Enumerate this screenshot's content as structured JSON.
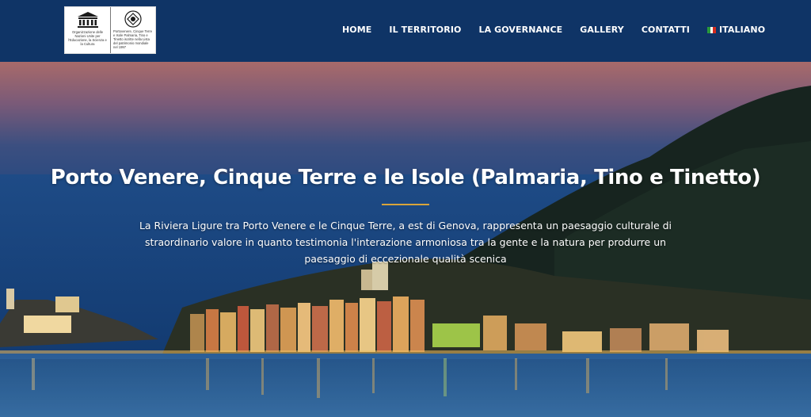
{
  "header": {
    "logo": {
      "unesco_text": "Organizzazione delle Nazioni Unite per l'Educazione, la Scienza e la Cultura",
      "site_text": "Portovenere, Cinque Terre e Isole Palmaria, Tino e Tinetto iscritte nella Lista del patrimonio mondiale nel 1997"
    },
    "nav": [
      {
        "label": "HOME"
      },
      {
        "label": "IL TERRITORIO"
      },
      {
        "label": "LA GOVERNANCE"
      },
      {
        "label": "GALLERY"
      },
      {
        "label": "CONTATTI"
      },
      {
        "label": "ITALIANO"
      }
    ]
  },
  "hero": {
    "title": "Porto Venere, Cinque Terre e le Isole (Palmaria, Tino e Tinetto)",
    "description": "La Riviera Ligure tra Porto Venere e le Cinque Terre, a est di Genova, rappresenta un paesaggio culturale di straordinario valore in quanto testimonia l'interazione armoniosa tra la gente e la natura per produrre un paesaggio di eccezionale qualità scenica"
  },
  "colors": {
    "header_bg": "#0f3466",
    "accent_divider": "#d9a43a",
    "flag": [
      "#2a9a3c",
      "#ffffff",
      "#d52b1e"
    ]
  }
}
